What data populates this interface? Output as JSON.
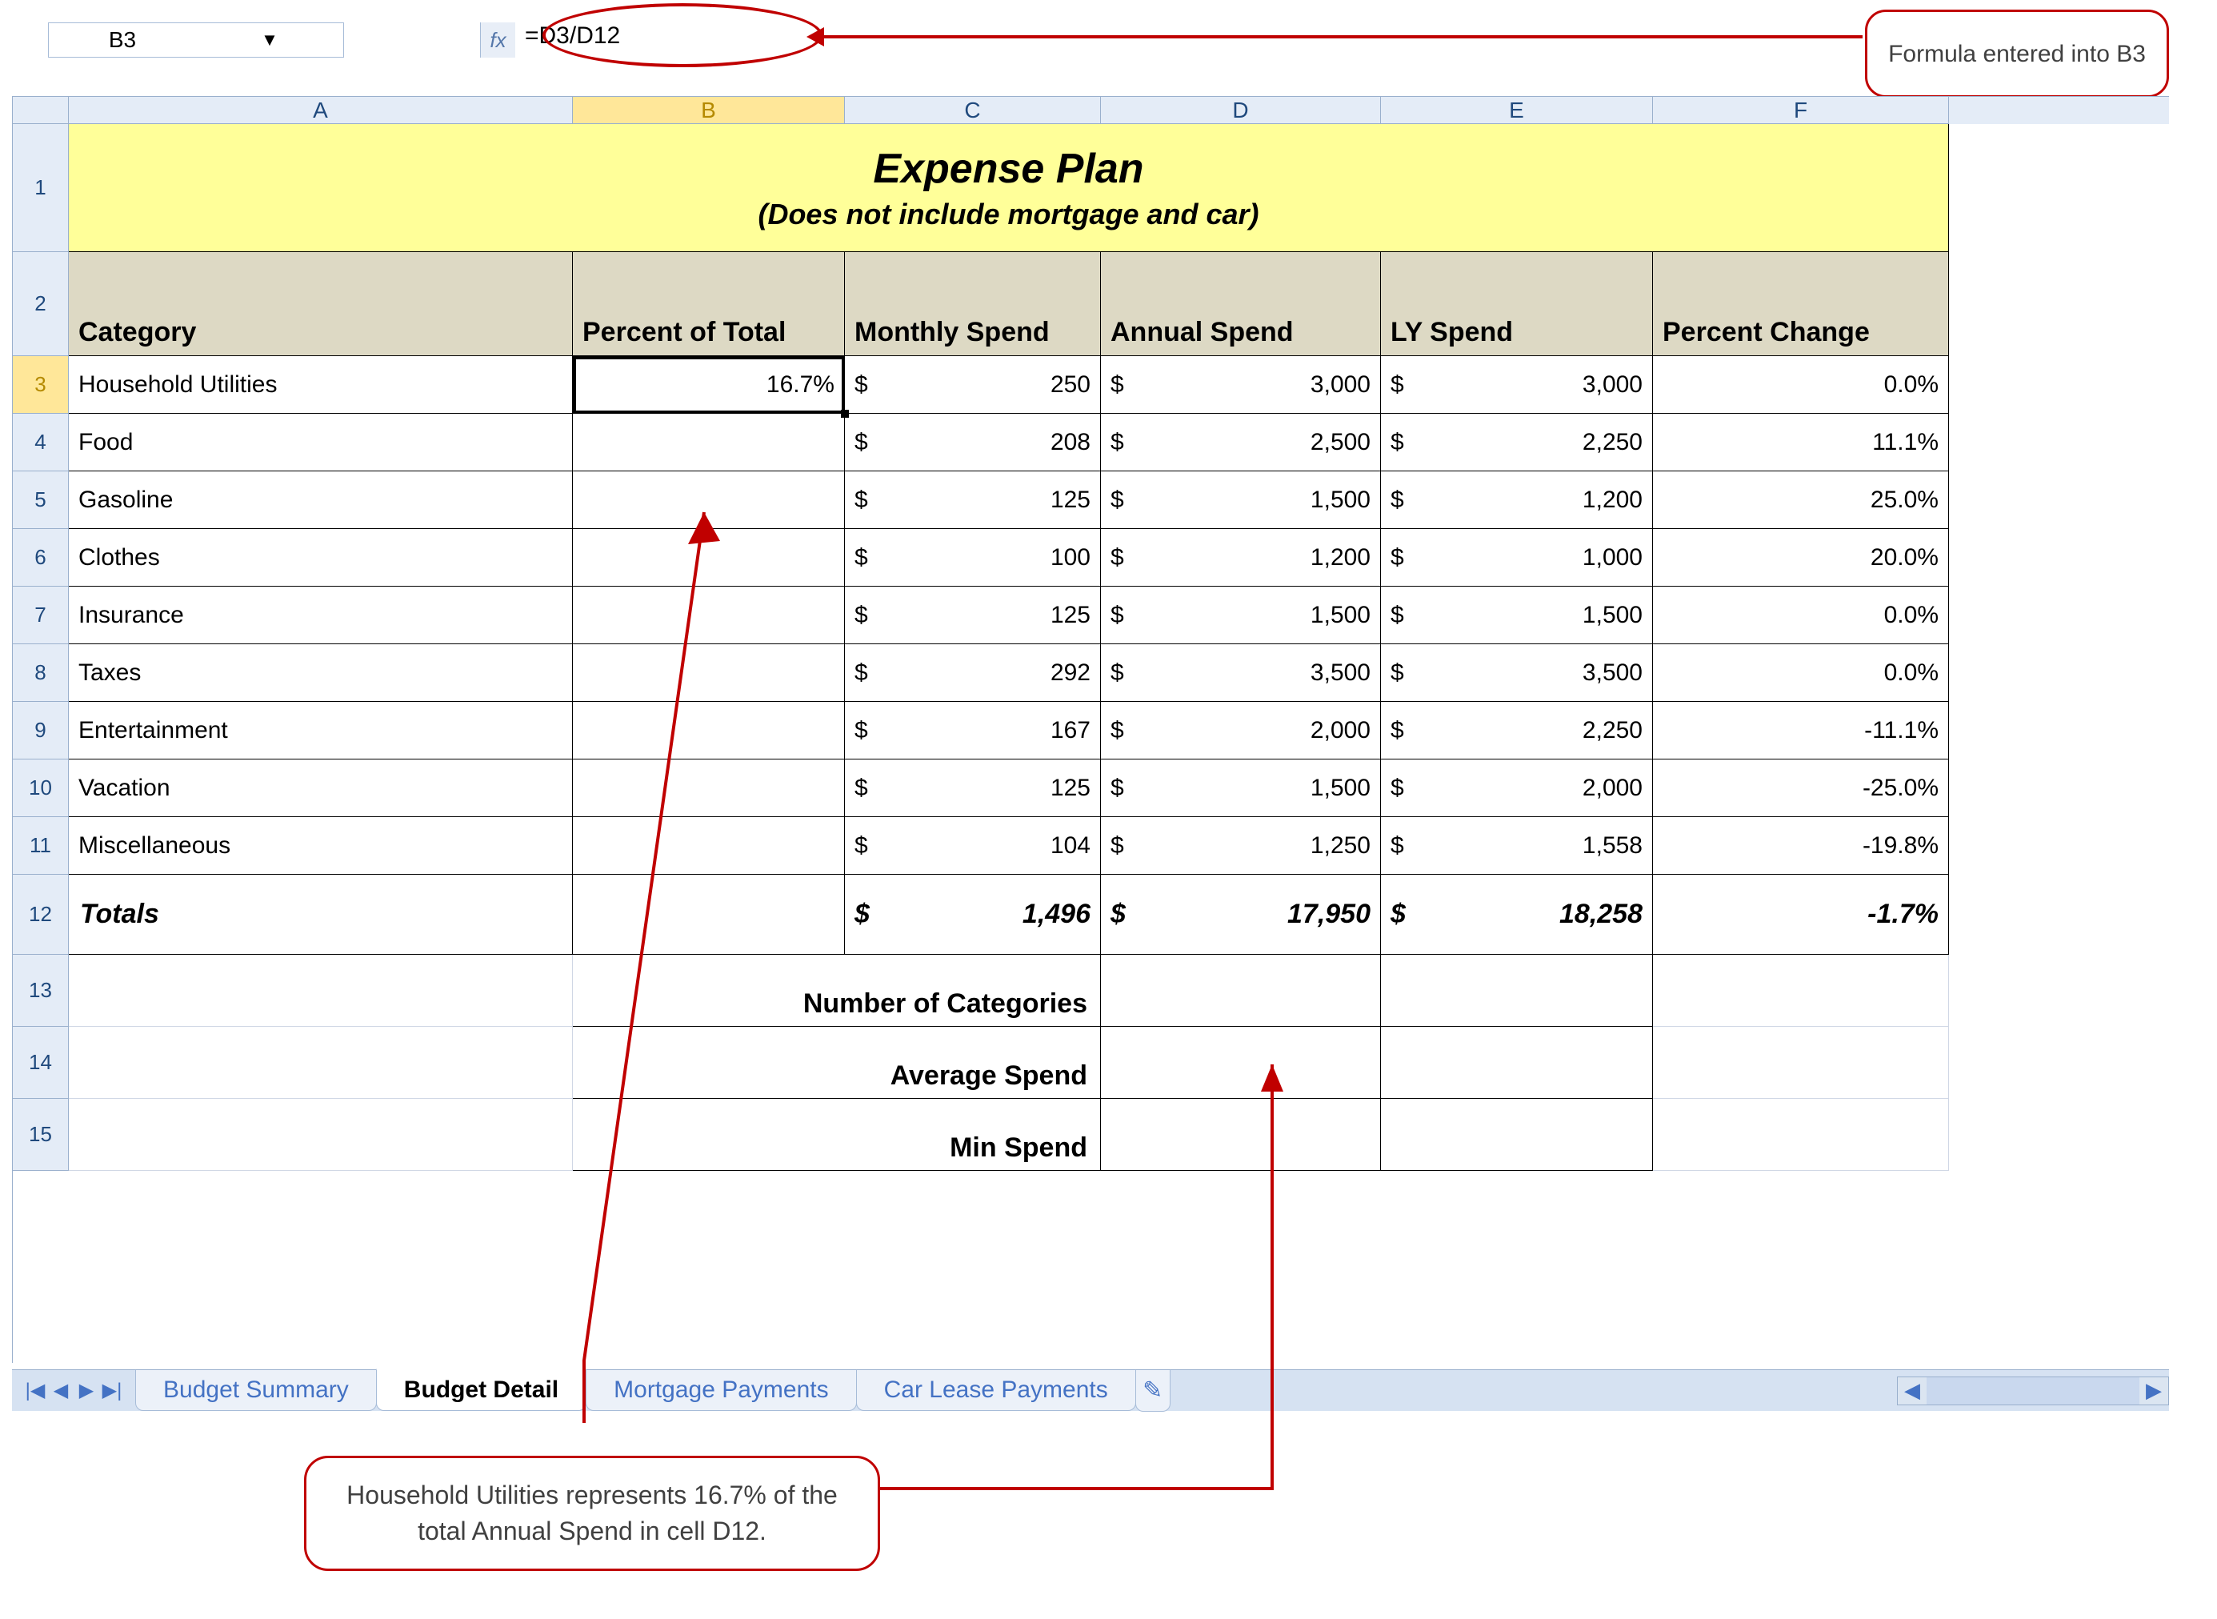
{
  "formula_bar": {
    "namebox": "B3",
    "fx_label": "fx",
    "formula": "=D3/D12"
  },
  "callouts": {
    "top_right": "Formula entered into B3",
    "bottom": "Household Utilities represents 16.7% of the total Annual Spend in cell D12."
  },
  "columns": [
    "A",
    "B",
    "C",
    "D",
    "E",
    "F"
  ],
  "title": {
    "line1": "Expense Plan",
    "line2": "(Does not include mortgage and car)"
  },
  "headers": {
    "category": "Category",
    "percent_total": "Percent of Total",
    "monthly_spend": "Monthly Spend",
    "annual_spend": "Annual Spend",
    "ly_spend": "LY Spend",
    "percent_change": "Percent Change"
  },
  "rows": [
    {
      "n": "3",
      "cat": "Household Utilities",
      "pct": "16.7%",
      "ms": "250",
      "as": "3,000",
      "ly": "3,000",
      "pc": "0.0%"
    },
    {
      "n": "4",
      "cat": "Food",
      "pct": "",
      "ms": "208",
      "as": "2,500",
      "ly": "2,250",
      "pc": "11.1%"
    },
    {
      "n": "5",
      "cat": "Gasoline",
      "pct": "",
      "ms": "125",
      "as": "1,500",
      "ly": "1,200",
      "pc": "25.0%"
    },
    {
      "n": "6",
      "cat": "Clothes",
      "pct": "",
      "ms": "100",
      "as": "1,200",
      "ly": "1,000",
      "pc": "20.0%"
    },
    {
      "n": "7",
      "cat": "Insurance",
      "pct": "",
      "ms": "125",
      "as": "1,500",
      "ly": "1,500",
      "pc": "0.0%"
    },
    {
      "n": "8",
      "cat": "Taxes",
      "pct": "",
      "ms": "292",
      "as": "3,500",
      "ly": "3,500",
      "pc": "0.0%"
    },
    {
      "n": "9",
      "cat": "Entertainment",
      "pct": "",
      "ms": "167",
      "as": "2,000",
      "ly": "2,250",
      "pc": "-11.1%"
    },
    {
      "n": "10",
      "cat": "Vacation",
      "pct": "",
      "ms": "125",
      "as": "1,500",
      "ly": "2,000",
      "pc": "-25.0%"
    },
    {
      "n": "11",
      "cat": "Miscellaneous",
      "pct": "",
      "ms": "104",
      "as": "1,250",
      "ly": "1,558",
      "pc": "-19.8%"
    }
  ],
  "totals": {
    "n": "12",
    "label": "Totals",
    "ms": "1,496",
    "as": "17,950",
    "ly": "18,258",
    "pc": "-1.7%"
  },
  "summary_labels": {
    "r13": {
      "n": "13",
      "label": "Number of Categories"
    },
    "r14": {
      "n": "14",
      "label": "Average Spend"
    },
    "r15": {
      "n": "15",
      "label": "Min Spend"
    }
  },
  "tabs": {
    "nav": [
      "⏮",
      "◀",
      "▶",
      "⏭"
    ],
    "items": [
      "Budget Summary",
      "Budget Detail",
      "Mortgage Payments",
      "Car Lease Payments"
    ],
    "active": 1,
    "newtab_icon": "✎"
  },
  "currency_symbol": "$"
}
